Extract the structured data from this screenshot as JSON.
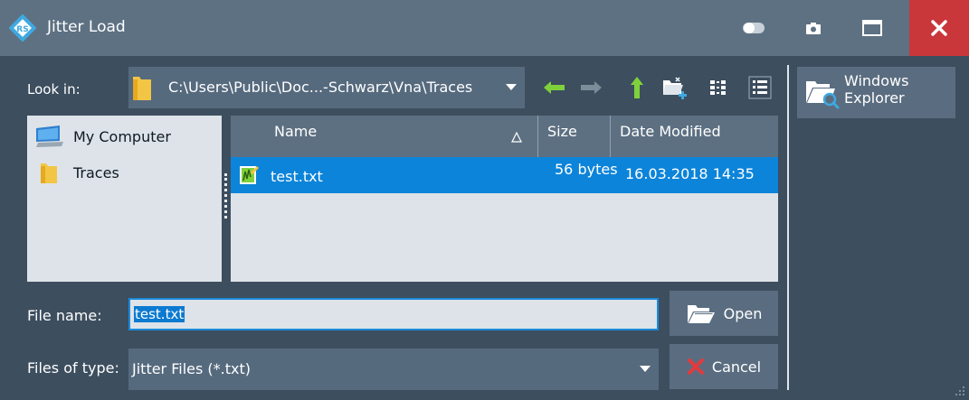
{
  "window": {
    "title": "Jitter Load"
  },
  "look_in": {
    "label": "Look in:",
    "path": "C:\\Users\\Public\\Doc...-Schwarz\\Vna\\Traces"
  },
  "places": [
    {
      "label": "My Computer",
      "icon": "computer-icon"
    },
    {
      "label": "Traces",
      "icon": "folder-icon"
    }
  ],
  "file_list": {
    "columns": [
      "Name",
      "Size",
      "Date Modified"
    ],
    "rows": [
      {
        "name": "test.txt",
        "size": "56 bytes",
        "date": "16.03.2018 14:35",
        "selected": true
      }
    ]
  },
  "file_name": {
    "label": "File name:",
    "value": "test.txt"
  },
  "file_type": {
    "label": "Files of type:",
    "value": "Jitter Files (*.txt)"
  },
  "buttons": {
    "open": "Open",
    "cancel": "Cancel",
    "explorer_line1": "Windows",
    "explorer_line2": "Explorer"
  },
  "colors": {
    "titlebar": "#5e7183",
    "background": "#3d4e5f",
    "selection": "#0c84d9",
    "close": "#c9373a",
    "accent_green": "#7fd13b"
  }
}
